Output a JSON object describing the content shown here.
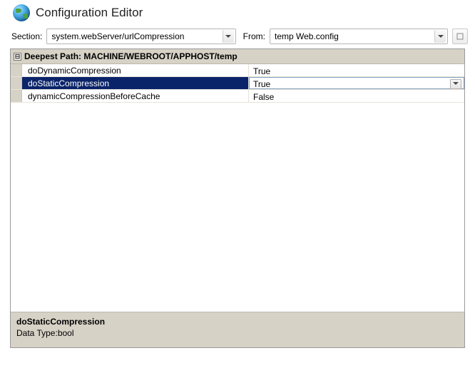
{
  "header": {
    "title": "Configuration Editor"
  },
  "toolbar": {
    "section_label": "Section:",
    "section_value": "system.webServer/urlCompression",
    "from_label": "From:",
    "from_value": "temp Web.config"
  },
  "grid": {
    "header_text": "Deepest Path: MACHINE/WEBROOT/APPHOST/temp",
    "collapse_glyph": "⊟",
    "rows": [
      {
        "name": "doDynamicCompression",
        "value": "True",
        "selected": false
      },
      {
        "name": "doStaticCompression",
        "value": "True",
        "selected": true
      },
      {
        "name": "dynamicCompressionBeforeCache",
        "value": "False",
        "selected": false
      }
    ]
  },
  "description": {
    "title": "doStaticCompression",
    "datatype": "Data Type:bool"
  }
}
